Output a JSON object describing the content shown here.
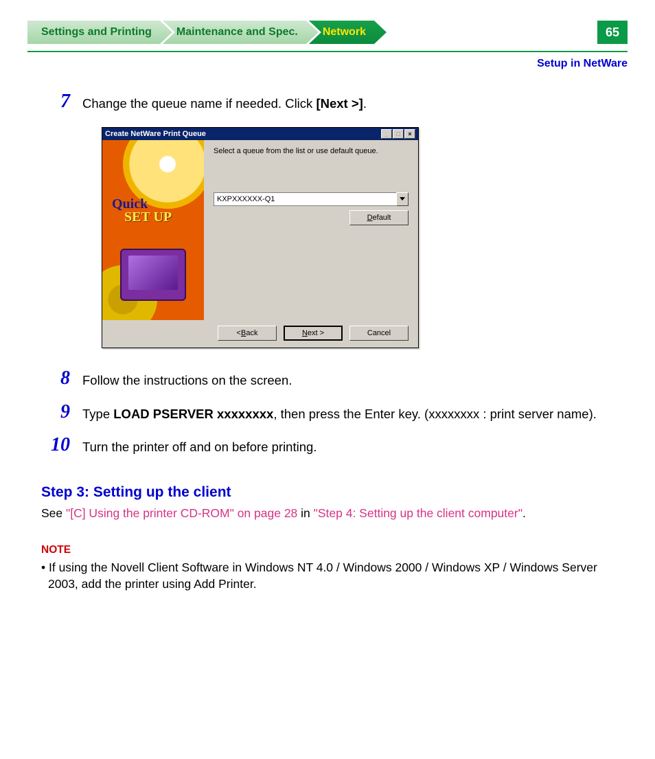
{
  "tabs": {
    "settings": "Settings and Printing",
    "maintenance": "Maintenance and Spec.",
    "network": "Network"
  },
  "page_number": "65",
  "breadcrumb": "Setup in NetWare",
  "steps": {
    "s7": {
      "num": "7",
      "text_a": "Change the queue name if needed. Click ",
      "bold": "[Next >]",
      "text_b": "."
    },
    "s8": {
      "num": "8",
      "text": "Follow the instructions on the screen."
    },
    "s9": {
      "num": "9",
      "text_a": "Type ",
      "bold": "LOAD PSERVER xxxxxxxx",
      "text_b": ", then press the Enter key. (xxxxxxxx : print server name)."
    },
    "s10": {
      "num": "10",
      "text": "Turn the printer off and on before printing."
    }
  },
  "dialog": {
    "title": "Create NetWare Print Queue",
    "instruction": "Select a queue from the list or use default queue.",
    "combo_value": "KXPXXXXXX-Q1",
    "left_art": {
      "line1": "Quick",
      "line2": "SET UP"
    },
    "buttons": {
      "default_prefix": "D",
      "default_rest": "efault",
      "back_prefix": "< ",
      "back_ul": "B",
      "back_rest": "ack",
      "next_ul": "N",
      "next_rest": "ext >",
      "cancel": "Cancel"
    },
    "win_controls": {
      "min": "_",
      "max": "□",
      "close": "×"
    }
  },
  "section": {
    "heading": "Step 3: Setting up the client",
    "see": "See ",
    "link1": "\"[C] Using the printer CD-ROM\" on page 28",
    "in": " in ",
    "link2": "\"Step 4: Setting up the client computer\"",
    "period": "."
  },
  "note": {
    "label": "NOTE",
    "bullet": "• If using the Novell Client Software in Windows NT 4.0 / Windows 2000 / Windows XP / Windows Server 2003, add the printer using Add Printer."
  }
}
